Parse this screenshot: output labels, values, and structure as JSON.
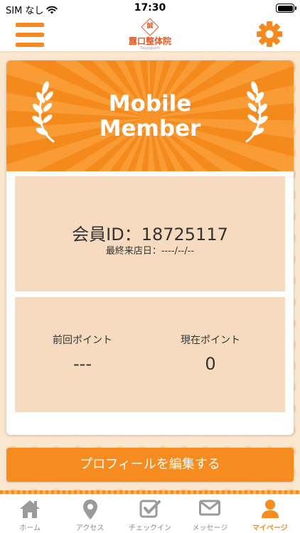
{
  "status_bar": {
    "carrier": "SIM なし",
    "time": "17:30"
  },
  "header": {
    "logo_mark": "誠",
    "logo_name": "露口整体院",
    "logo_sub": "Tsuyuguchi",
    "accent_color": "#f5891f"
  },
  "card": {
    "title_line1": "Mobile",
    "title_line2": "Member",
    "member_id": "会員ID：18725117",
    "last_visit": "最終来店日：----/--/--",
    "previous_points_label": "前回ポイント",
    "previous_points_value": "---",
    "current_points_label": "現在ポイント",
    "current_points_value": "0"
  },
  "edit_profile_label": "プロフィールを編集する",
  "tabs": [
    {
      "label": "ホーム",
      "icon": "home-icon",
      "active": false
    },
    {
      "label": "アクセス",
      "icon": "map-pin-icon",
      "active": false
    },
    {
      "label": "チェックイン",
      "icon": "checkin-icon",
      "active": false
    },
    {
      "label": "メッセージ",
      "icon": "mail-icon",
      "active": false
    },
    {
      "label": "マイページ",
      "icon": "person-icon",
      "active": true
    }
  ]
}
